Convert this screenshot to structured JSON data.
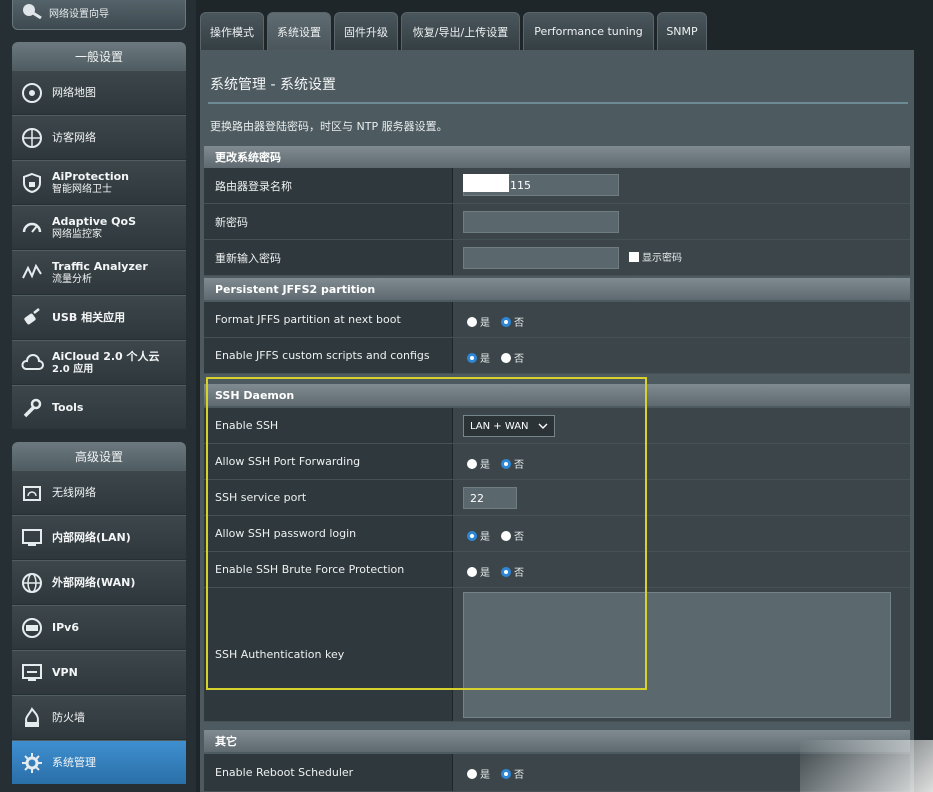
{
  "sidebar": {
    "top_button_label": "网络设置向导",
    "general_header": "一般设置",
    "general_items": [
      {
        "title": "网络地图",
        "sub": ""
      },
      {
        "title": "访客网络",
        "sub": ""
      },
      {
        "title": "AiProtection",
        "sub": "智能网络卫士"
      },
      {
        "title": "Adaptive QoS",
        "sub": "网络监控家"
      },
      {
        "title": "Traffic Analyzer",
        "sub": "流量分析"
      },
      {
        "title": "USB 相关应用",
        "sub": ""
      },
      {
        "title": "AiCloud 2.0 个人云",
        "sub": "2.0 应用"
      },
      {
        "title": "Tools",
        "sub": ""
      }
    ],
    "advanced_header": "高级设置",
    "advanced_items": [
      {
        "title": "无线网络"
      },
      {
        "title": "内部网络(LAN)"
      },
      {
        "title": "外部网络(WAN)"
      },
      {
        "title": "IPv6"
      },
      {
        "title": "VPN"
      },
      {
        "title": "防火墙"
      },
      {
        "title": "系统管理"
      }
    ]
  },
  "tabs": [
    "操作模式",
    "系统设置",
    "固件升级",
    "恢复/导出/上传设置",
    "Performance tuning",
    "SNMP"
  ],
  "page": {
    "title": "系统管理 - 系统设置",
    "description": "更换路由器登陆密码，时区与 NTP 服务器设置。"
  },
  "sections": {
    "password": {
      "header": "更改系统密码",
      "login_name_label": "路由器登录名称",
      "login_name_value": "115",
      "new_password_label": "新密码",
      "confirm_password_label": "重新输入密码",
      "show_password_label": "显示密码"
    },
    "jffs": {
      "header": "Persistent JFFS2 partition",
      "format_label": "Format JFFS partition at next boot",
      "scripts_label": "Enable JFFS custom scripts and configs"
    },
    "ssh": {
      "header": "SSH Daemon",
      "enable_label": "Enable SSH",
      "enable_value": "LAN + WAN",
      "port_forward_label": "Allow SSH Port Forwarding",
      "port_label": "SSH service port",
      "port_value": "22",
      "password_login_label": "Allow SSH password login",
      "brute_force_label": "Enable SSH Brute Force Protection",
      "auth_key_label": "SSH Authentication key"
    },
    "other": {
      "header": "其它",
      "reboot_label": "Enable Reboot Scheduler"
    }
  },
  "radio": {
    "yes": "是",
    "no": "否"
  },
  "colors": {
    "accent": "#2e86d6",
    "highlight": "#d7d12d"
  }
}
